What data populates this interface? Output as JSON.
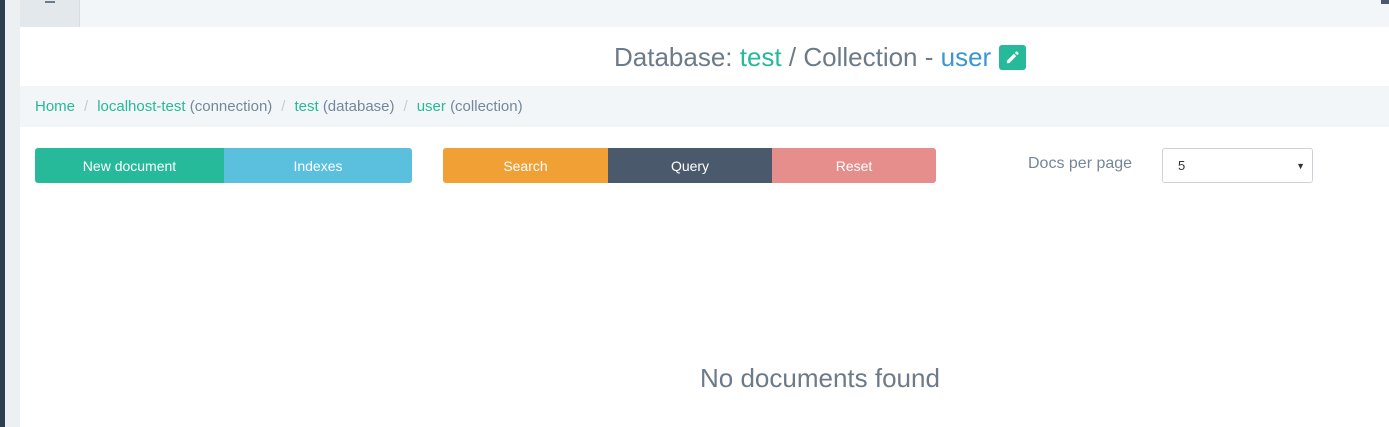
{
  "header": {
    "menu_icon": "hamburger-icon",
    "corner_icon": "plug-icon"
  },
  "title": {
    "prefix": "Database: ",
    "database": "test",
    "middle": " / Collection - ",
    "collection": "user",
    "edit_icon": "pencil-icon"
  },
  "breadcrumb": {
    "home": "Home",
    "connection_name": "localhost-test",
    "connection_note": "(connection)",
    "database_name": "test",
    "database_note": "(database)",
    "collection_name": "user",
    "collection_note": "(collection)",
    "separator": "/"
  },
  "toolbar": {
    "new_document": "New document",
    "indexes": "Indexes",
    "search": "Search",
    "query": "Query",
    "reset": "Reset"
  },
  "pagination": {
    "label": "Docs per page",
    "selected": "5"
  },
  "results": {
    "empty_message": "No documents found"
  },
  "colors": {
    "accent_green": "#26b99a",
    "accent_blue": "#3a97d4",
    "indexes": "#5bc0de",
    "search": "#f0a035",
    "query": "#4a5a6c",
    "reset": "#e68e8c"
  }
}
